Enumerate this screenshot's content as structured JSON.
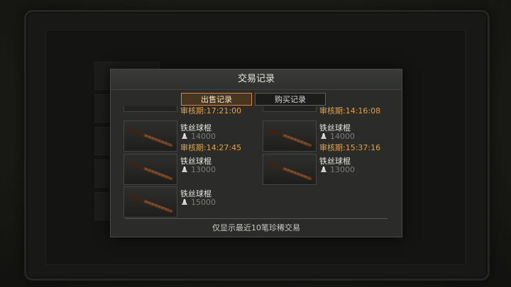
{
  "dialog": {
    "title": "交易记录",
    "tabs": [
      {
        "label": "出售记录",
        "active": true
      },
      {
        "label": "购买记录",
        "active": false
      }
    ],
    "partial_top": [
      {
        "review": "审核期:17:21:00"
      },
      {
        "review": "审核期:14:16:08"
      }
    ],
    "items": [
      {
        "name": "铁丝球棍",
        "price": "14000",
        "review": "审核期:14:27:45",
        "icon": "spiked-bat-icon"
      },
      {
        "name": "铁丝球棍",
        "price": "14000",
        "review": "审核期:15:37:16",
        "icon": "spiked-bat-icon"
      },
      {
        "name": "铁丝球棍",
        "price": "13000",
        "review": "",
        "icon": "spiked-bat-icon"
      },
      {
        "name": "铁丝球棍",
        "price": "13000",
        "review": "",
        "icon": "spiked-bat-icon"
      },
      {
        "name": "铁丝球棍",
        "price": "15000",
        "review": "",
        "icon": "spiked-bat-icon"
      }
    ],
    "footer_note": "仅显示最近10笔珍稀交易",
    "colors": {
      "accent": "#d9843a",
      "review": "#e0a244",
      "price": "#7c7c76"
    }
  }
}
